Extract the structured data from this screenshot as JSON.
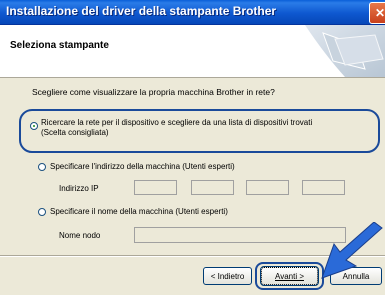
{
  "window": {
    "title": "Installazione del driver della stampante Brother",
    "close_glyph": "✕"
  },
  "header": {
    "title": "Seleziona stampante"
  },
  "main": {
    "question": "Scegliere come visualizzare la propria macchina Brother in rete?",
    "options": [
      {
        "line1": "Ricercare la rete per il dispositivo e scegliere da una lista di dispositivi trovati",
        "line2": "(Scelta consigliata)",
        "checked": true
      },
      {
        "line1": "Specificare l'indirizzo della macchina (Utenti esperti)",
        "checked": false
      },
      {
        "line1": "Specificare il nome della macchina (Utenti esperti)",
        "checked": false
      }
    ],
    "ip_label": "Indirizzo IP",
    "ip_octets": [
      "",
      "",
      "",
      ""
    ],
    "node_label": "Nome nodo",
    "node_value": ""
  },
  "buttons": {
    "back_label": "< Indietro",
    "next_label": "Avanti >",
    "cancel_label": "Annulla"
  },
  "colors": {
    "titlebar": "#0e58d0",
    "highlight_border": "#1a4a9a",
    "arrow": "#2a6ad8"
  }
}
